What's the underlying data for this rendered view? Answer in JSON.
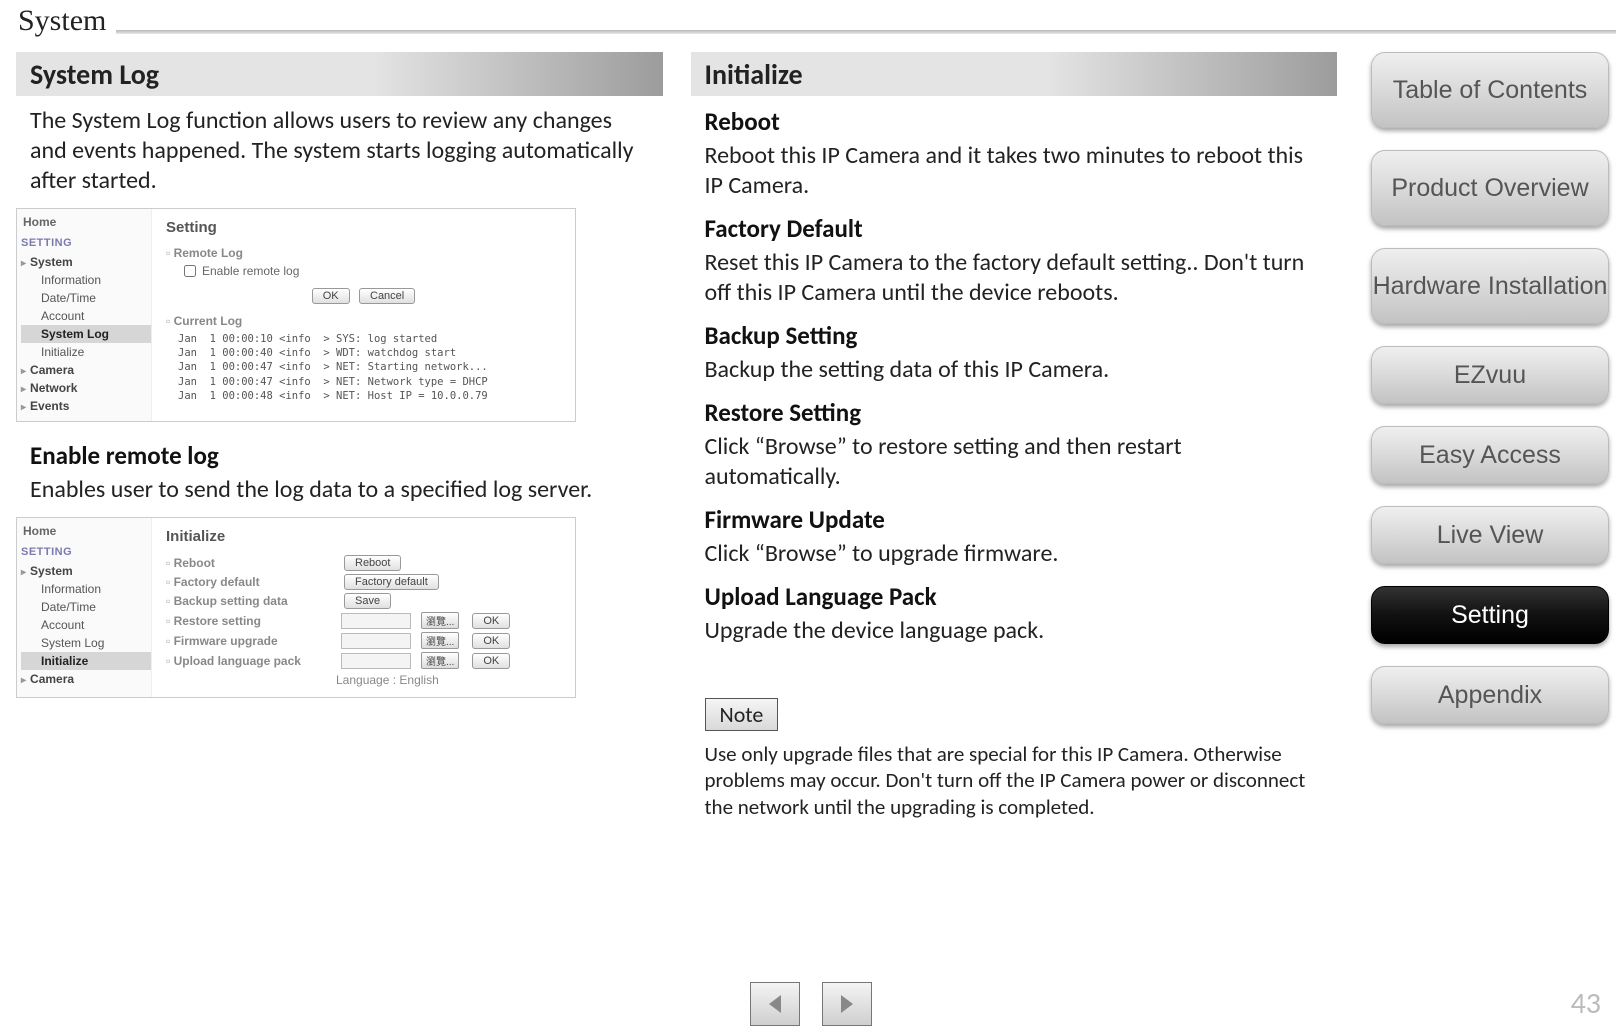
{
  "header": {
    "title": "System"
  },
  "page_number": "43",
  "left": {
    "section_title": "System Log",
    "intro": "The System Log function allows users to review any changes and events happened. The system starts logging automatically after started.",
    "shot1": {
      "title": "Setting",
      "home": "Home",
      "group": "SETTING",
      "nav": [
        "System",
        "Information",
        "Date/Time",
        "Account",
        "System Log",
        "Initialize",
        "Camera",
        "Network",
        "Events"
      ],
      "nav_selected": "System Log",
      "remote_group": "Remote Log",
      "enable_label": "Enable remote log",
      "ok": "OK",
      "cancel": "Cancel",
      "current_log": "Current Log",
      "logs": [
        "Jan  1 00:00:10 <info  > SYS: log started",
        "Jan  1 00:00:40 <info  > WDT: watchdog start",
        "Jan  1 00:00:47 <info  > NET: Starting network...",
        "Jan  1 00:00:47 <info  > NET: Network type = DHCP",
        "Jan  1 00:00:48 <info  > NET: Host IP = 10.0.0.79"
      ]
    },
    "sub_head": "Enable remote log",
    "sub_body": "Enables user to send the log data to a specified log server.",
    "shot2": {
      "title": "Initialize",
      "home": "Home",
      "group": "SETTING",
      "nav": [
        "System",
        "Information",
        "Date/Time",
        "Account",
        "System Log",
        "Initialize",
        "Camera"
      ],
      "nav_selected": "Initialize",
      "rows": [
        {
          "label": "Reboot",
          "btn": "Reboot"
        },
        {
          "label": "Factory default",
          "btn": "Factory default"
        },
        {
          "label": "Backup setting data",
          "btn": "Save"
        },
        {
          "label": "Restore setting",
          "file": true,
          "browse": "瀏覽...",
          "ok": "OK"
        },
        {
          "label": "Firmware upgrade",
          "file": true,
          "browse": "瀏覽...",
          "ok": "OK"
        },
        {
          "label": "Upload language pack",
          "file": true,
          "browse": "瀏覽...",
          "ok": "OK"
        }
      ],
      "lang": "Language : English"
    }
  },
  "right": {
    "section_title": "Initialize",
    "reboot_h": "Reboot",
    "reboot_b": "Reboot this IP Camera and it takes two minutes to reboot this IP Camera.",
    "factory_h": "Factory Default",
    "factory_b": "Reset this IP Camera to the factory default setting.. Don't turn off this IP Camera until the device reboots.",
    "backup_h": "Backup Setting",
    "backup_b": "Backup the setting data of this IP Camera.",
    "restore_h": "Restore Setting",
    "restore_b": "Click “Browse” to restore setting and then restart automatically.",
    "fw_h": "Firmware Update",
    "fw_b": "Click “Browse” to upgrade firmware.",
    "lang_h": "Upload Language Pack",
    "lang_b": "Upgrade the device language pack.",
    "note_label": "Note",
    "note_body": "Use only upgrade files that are special for this IP Camera. Otherwise problems may occur. Don't turn off the IP Camera power or disconnect the network until the upgrading is completed."
  },
  "nav": {
    "items": [
      "Table of Contents",
      "Product Overview",
      "Hardware Installation",
      "EZvuu",
      "Easy Access",
      "Live View",
      "Setting",
      "Appendix"
    ],
    "active": "Setting"
  }
}
